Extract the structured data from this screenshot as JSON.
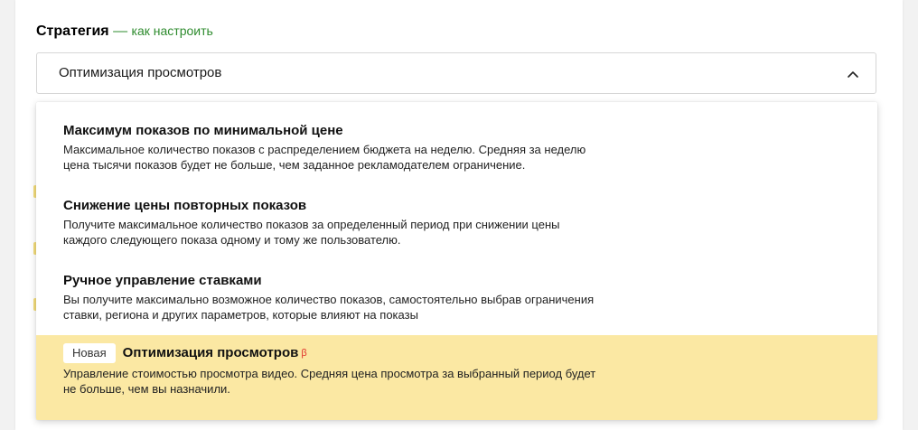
{
  "strategy": {
    "title": "Стратегия",
    "separator": " — ",
    "help_link": "как настроить"
  },
  "select": {
    "value": "Оптимизация просмотров",
    "chevron_icon": "chevron-up-icon"
  },
  "options": [
    {
      "title": "Максимум показов по минимальной цене",
      "desc_line1": "Максимальное количество показов с распределением бюджета на неделю. Средняя за неделю",
      "desc_line2": "цена тысячи показов будет не больше, чем заданное рекламодателем ограничение."
    },
    {
      "title": "Снижение цены повторных показов",
      "desc_line1": "Получите максимальное количество показов за определенный период при снижении цены",
      "desc_line2": "каждого следующего показа одному и тому же пользователю."
    },
    {
      "title": "Ручное управление ставками",
      "desc_line1": "Вы получите максимально возможное количество показов, самостоятельно выбрав ограничения",
      "desc_line2": "ставки, региона и других параметров, которые влияют на показы"
    },
    {
      "badge": "Новая",
      "title": "Оптимизация просмотров",
      "beta": "β",
      "desc_line1": "Управление стоимостью просмотра видео. Средняя цена просмотра за выбранный период будет",
      "desc_line2": "не больше, чем вы назначили."
    }
  ],
  "colors": {
    "link_green": "#2e8b2e",
    "selected_bg": "#fbe8a3",
    "beta_red": "#e0312b"
  }
}
